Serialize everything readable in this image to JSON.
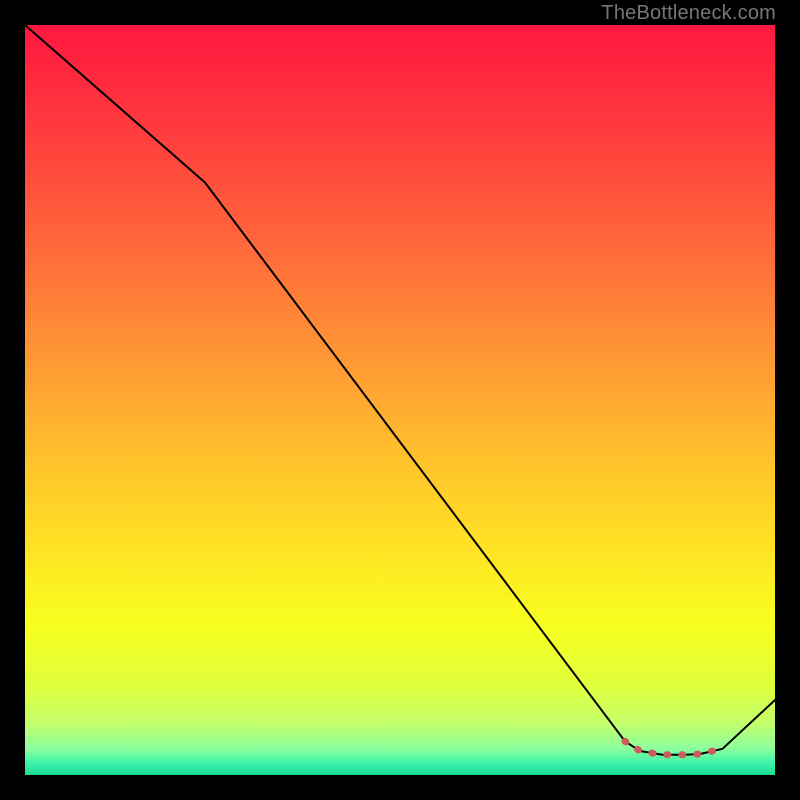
{
  "attribution": "TheBottleneck.com",
  "chart_data": {
    "type": "line",
    "title": "",
    "xlabel": "",
    "ylabel": "",
    "xlim": [
      0,
      100
    ],
    "ylim": [
      0,
      100
    ],
    "series": [
      {
        "name": "curve",
        "color": "#000000",
        "x": [
          0,
          24,
          80,
          82,
          85,
          88,
          90,
          93,
          100
        ],
        "y": [
          100,
          79,
          4.5,
          3.2,
          2.7,
          2.7,
          2.8,
          3.5,
          10
        ]
      }
    ],
    "markers": {
      "name": "highlight",
      "color": "#cc5c5c",
      "x": [
        80,
        82,
        85,
        88,
        90,
        93
      ],
      "y": [
        4.5,
        3.2,
        2.7,
        2.7,
        2.8,
        3.5
      ]
    },
    "background_gradient": {
      "stops": [
        {
          "offset": 0.0,
          "color": "#ff173f"
        },
        {
          "offset": 0.14,
          "color": "#ff3b3e"
        },
        {
          "offset": 0.3,
          "color": "#ff6a3a"
        },
        {
          "offset": 0.45,
          "color": "#ff9934"
        },
        {
          "offset": 0.58,
          "color": "#ffc22c"
        },
        {
          "offset": 0.7,
          "color": "#ffe324"
        },
        {
          "offset": 0.8,
          "color": "#f7ff1f"
        },
        {
          "offset": 0.88,
          "color": "#e0ff3c"
        },
        {
          "offset": 0.93,
          "color": "#c4ff6a"
        },
        {
          "offset": 0.965,
          "color": "#8bff9d"
        },
        {
          "offset": 0.985,
          "color": "#3af2ab"
        },
        {
          "offset": 1.0,
          "color": "#17d98f"
        }
      ]
    }
  }
}
